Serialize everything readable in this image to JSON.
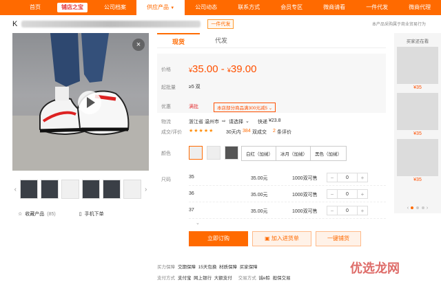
{
  "nav": {
    "items": [
      "首页",
      "铺店之宝",
      "公司档案",
      "供应产品",
      "公司动态",
      "联系方式",
      "会员专区",
      "微商请看",
      "一件代发",
      "微商代理"
    ]
  },
  "title": {
    "prefix": "K",
    "tag": "一件代发",
    "right_note": "本产品采购属于商业贸易行为"
  },
  "gallery": {
    "collect_label": "收藏产品",
    "collect_count": "(85)",
    "mobile_order": "手机下单"
  },
  "tabs": [
    "现货",
    "代发"
  ],
  "price": {
    "label": "价格",
    "symbol": "¥",
    "min": "35.00",
    "max": "39.00",
    "moq_label": "起批量",
    "moq": "≥5 双"
  },
  "promo": {
    "label": "优惠",
    "tag": "满批",
    "coupon": "本店部分商品满300元减5"
  },
  "logistics": {
    "label": "物流",
    "from": "浙江省 温州市",
    "to": "请选择",
    "fee_label": "快递",
    "fee": "¥23.8"
  },
  "rating": {
    "label": "成交/评价",
    "stars": "★★★★★",
    "days": "30天内",
    "deals": "384",
    "deals_unit": "双成交",
    "reviews": "2",
    "reviews_unit": "条评价"
  },
  "color": {
    "label": "颜色",
    "options": [
      "白红（加绒）",
      "冰月（加绒）",
      "黑色（加绒）"
    ]
  },
  "sizes": {
    "label": "尺码",
    "rows": [
      {
        "size": "35",
        "price": "35.00元",
        "stock": "1000双可售",
        "qty": "0"
      },
      {
        "size": "36",
        "price": "35.00元",
        "stock": "1000双可售",
        "qty": "0"
      },
      {
        "size": "37",
        "price": "35.00元",
        "stock": "1000双可售",
        "qty": "0"
      }
    ]
  },
  "actions": {
    "order": "立即订购",
    "cart": "加入进货单",
    "dist": "一键铺货"
  },
  "service": {
    "guarantee_label": "买力保障",
    "guarantees": [
      "交期保障",
      "15天包换",
      "材质保障",
      "买家保障"
    ],
    "pay_label": "支付方式",
    "pays": [
      "支付宝",
      "网上银行",
      "大额支付"
    ],
    "cross_label": "交易方式",
    "cross": [
      "诚e赊",
      "担保交易"
    ]
  },
  "right_col": {
    "title": "买家还在看",
    "items": [
      {
        "price": "¥35"
      },
      {
        "price": "¥35"
      },
      {
        "price": "¥35"
      }
    ]
  },
  "watermark": "优选龙网"
}
